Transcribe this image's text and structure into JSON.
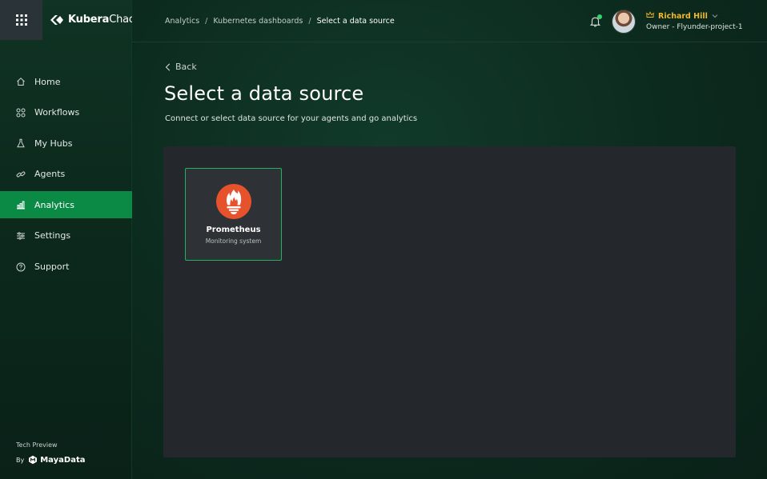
{
  "brand": {
    "name_bold": "Kubera",
    "name_regular": "Chaos"
  },
  "sidebar": {
    "items": [
      {
        "label": "Home",
        "icon": "home-icon"
      },
      {
        "label": "Workflows",
        "icon": "workflows-icon"
      },
      {
        "label": "My Hubs",
        "icon": "flask-icon"
      },
      {
        "label": "Agents",
        "icon": "link-icon"
      },
      {
        "label": "Analytics",
        "icon": "analytics-icon",
        "active": true
      },
      {
        "label": "Settings",
        "icon": "settings-icon"
      },
      {
        "label": "Support",
        "icon": "help-icon"
      }
    ],
    "footer": {
      "tech_preview": "Tech Preview",
      "by": "By",
      "company": "MayaData"
    }
  },
  "header": {
    "breadcrumb": [
      "Analytics",
      "Kubernetes dashboards",
      "Select a data source"
    ],
    "user": {
      "name": "Richard Hill",
      "role": "Owner - Flyunder-project-1"
    }
  },
  "page": {
    "back_label": "Back",
    "title": "Select a data source",
    "subtitle": "Connect or select data source for your agents and go analytics"
  },
  "datasources": [
    {
      "name": "Prometheus",
      "description": "Monitoring system",
      "icon": "prometheus-icon",
      "selected": true
    }
  ],
  "colors": {
    "accent": "#0a8a45",
    "selected_border": "#21b35f",
    "user_name": "#f2b928",
    "prometheus": "#e6522c"
  }
}
